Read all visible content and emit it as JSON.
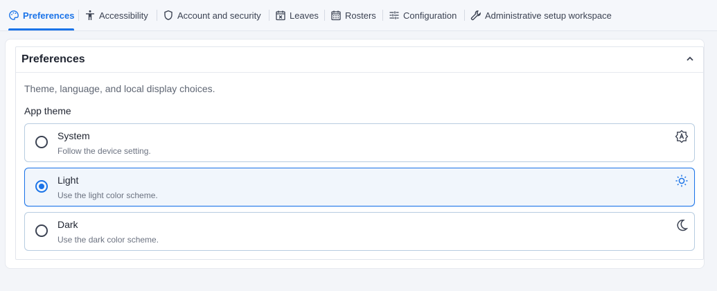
{
  "tabs": [
    {
      "label": "Preferences",
      "icon": "palette-icon",
      "active": true
    },
    {
      "label": "Accessibility",
      "icon": "accessibility-icon",
      "active": false
    },
    {
      "label": "Account and security",
      "icon": "shield-icon",
      "active": false
    },
    {
      "label": "Leaves",
      "icon": "calendar-x-icon",
      "active": false
    },
    {
      "label": "Rosters",
      "icon": "calendar-grid-icon",
      "active": false
    },
    {
      "label": "Configuration",
      "icon": "sliders-icon",
      "active": false
    },
    {
      "label": "Administrative setup workspace",
      "icon": "wrench-icon",
      "active": false
    }
  ],
  "panel": {
    "title": "Preferences",
    "collapse_icon": "chevron-up-icon",
    "description": "Theme, language, and local display choices.",
    "theme_label": "App theme",
    "options": [
      {
        "title": "System",
        "subtitle": "Follow the device setting.",
        "icon": "auto-brightness-icon",
        "selected": false
      },
      {
        "title": "Light",
        "subtitle": "Use the light color scheme.",
        "icon": "sun-icon",
        "selected": true
      },
      {
        "title": "Dark",
        "subtitle": "Use the dark color scheme.",
        "icon": "moon-icon",
        "selected": false
      }
    ]
  },
  "colors": {
    "accent": "#1a73e8",
    "border": "#b7cce0",
    "text": "#1f2430"
  }
}
